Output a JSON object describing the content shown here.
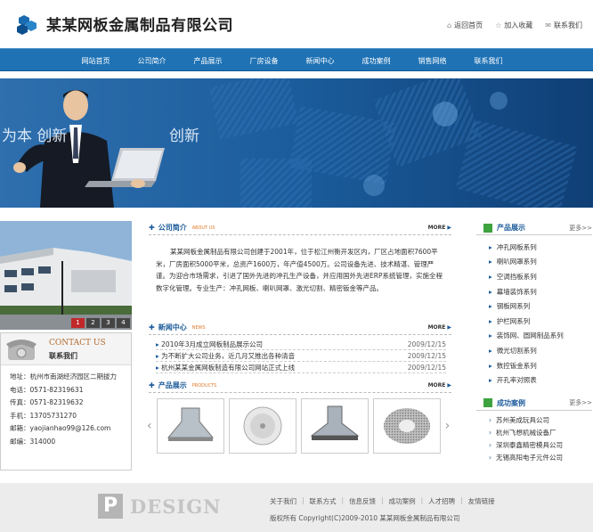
{
  "header": {
    "company": "某某网板金属制品有限公司",
    "links": [
      "返回首页",
      "加入收藏",
      "联系我们"
    ]
  },
  "nav": [
    "网站首页",
    "公司简介",
    "产品展示",
    "厂房设备",
    "新闻中心",
    "成功案例",
    "销售网络",
    "联系我们"
  ],
  "banner": {
    "slogan": "为本  创新"
  },
  "photo_pager": [
    "1",
    "2",
    "3",
    "4"
  ],
  "contact": {
    "en": "CONTACT US",
    "cn": "联系我们",
    "lines": [
      "地址：杭州市南湖经济园区二期拔力",
      "电话：0571-82319631",
      "传真：0571-82319632",
      "手机：13705731270",
      "邮箱：yaojianhao99@126.com",
      "邮编：314000"
    ]
  },
  "about": {
    "title": "公司简介",
    "en": "ABOUT US",
    "more": "MORE",
    "text": "某某网板金属制品有限公司创建于2001年，位于松江州衡开发区内，厂区占地面积7600平米，厂房面积5000平米，总资产1600万，年产值4500万。公司设备先进、技术精湛、管理严谨。为迎合市场需求，引进了国外先进的冲孔生产设备，并应用国外先进ERP系统管理，实施全程数字化管理。专业生产：冲孔网板、喇叭网罩、激光切割、精密钣金等产品。"
  },
  "news": {
    "title": "新闻中心",
    "en": "NEWS",
    "more": "MORE",
    "items": [
      {
        "t": "2010年3月成立网板制品展示公司",
        "d": "2009/12/15"
      },
      {
        "t": "为不断扩大公司业务，近几月又推出各种清音",
        "d": "2009/12/15"
      },
      {
        "t": "杭州某某金属网板制造有限公司网站正式上线",
        "d": "2009/12/15"
      }
    ]
  },
  "products": {
    "title": "产品展示",
    "en": "PRODUCTS",
    "more": "MORE"
  },
  "right_products": {
    "title": "产品展示",
    "more": "更多>>",
    "items": [
      "冲孔网板系列",
      "喇叭网罩系列",
      "空调挡板系列",
      "幕墙装饰系列",
      "钢板网系列",
      "护栏网系列",
      "装饰网、圆网制品系列",
      "微光切割系列",
      "数控钣金系列",
      "开孔率对照表"
    ]
  },
  "right_cases": {
    "title": "成功案例",
    "more": "更多>>",
    "items": [
      "苏州美成玩具公司",
      "杭州飞想机械设备厂",
      "深圳泰鑫精密模具公司",
      "无锡高阳电子元件公司"
    ]
  },
  "footer": {
    "links": [
      "关于我们",
      "联系方式",
      "信息反馈",
      "成功案例",
      "人才招聘",
      "友情链接"
    ],
    "copyright": "版权所有  Copyright(C)2009-2010 某某网板金属制品有限公司",
    "watermark": "DESIGN",
    "wm_p": "P"
  }
}
